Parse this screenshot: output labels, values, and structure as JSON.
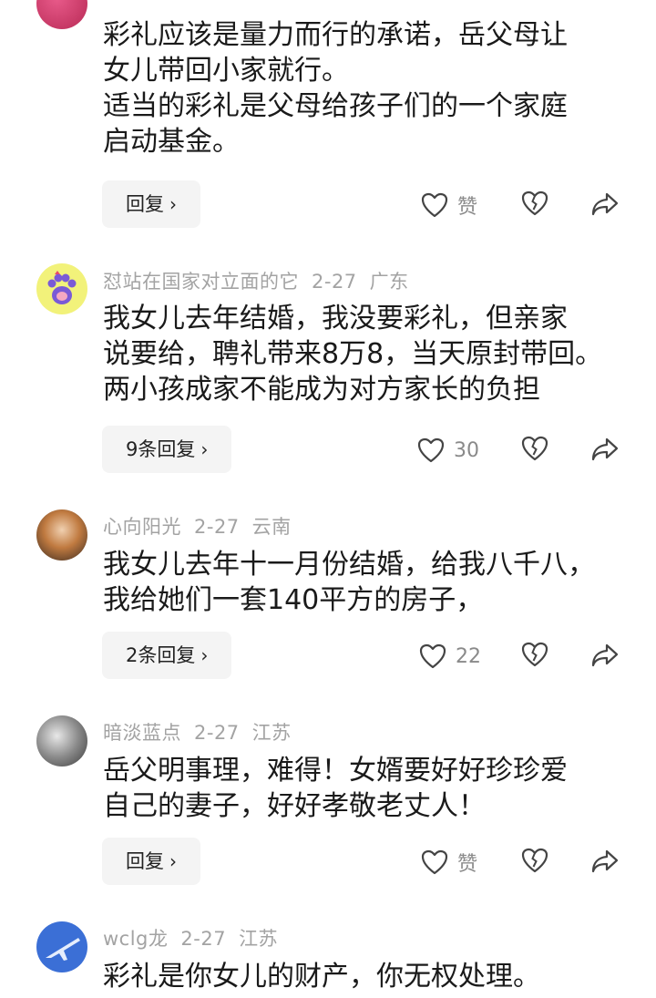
{
  "comments": [
    {
      "body": [
        "彩礼应该是量力而行的承诺，岳父母让",
        "女儿带回小家就行。",
        "适当的彩礼是父母给孩子们的一个家庭",
        "启动基金。"
      ],
      "reply_label": "回复",
      "like_label": "赞"
    },
    {
      "username": "怼站在国家对立面的它",
      "date": "2-27",
      "location": "广东",
      "body": [
        "我女儿去年结婚，我没要彩礼，但亲家",
        "说要给，聘礼带来8万8，当天原封带回。",
        "两小孩成家不能成为对方家长的负担"
      ],
      "reply_label": "9条回复",
      "like_label": "30"
    },
    {
      "username": "心向阳光",
      "date": "2-27",
      "location": "云南",
      "body": [
        "我女儿去年十一月份结婚，给我八千八，",
        "我给她们一套140平方的房子，"
      ],
      "reply_label": "2条回复",
      "like_label": "22"
    },
    {
      "username": "暗淡蓝点",
      "date": "2-27",
      "location": "江苏",
      "body": [
        "岳父明事理，难得！女婿要好好珍珍爱",
        "自己的妻子，好好孝敬老丈人！"
      ],
      "reply_label": "回复",
      "like_label": "赞"
    },
    {
      "username": "wclg龙",
      "date": "2-27",
      "location": "江苏",
      "body": [
        "彩礼是你女儿的财产，你无权处理。"
      ]
    }
  ],
  "icons": {
    "chevron": "chevron-right-icon",
    "like": "heart-icon",
    "dislike": "broken-heart-icon",
    "share": "share-arrow-icon"
  }
}
